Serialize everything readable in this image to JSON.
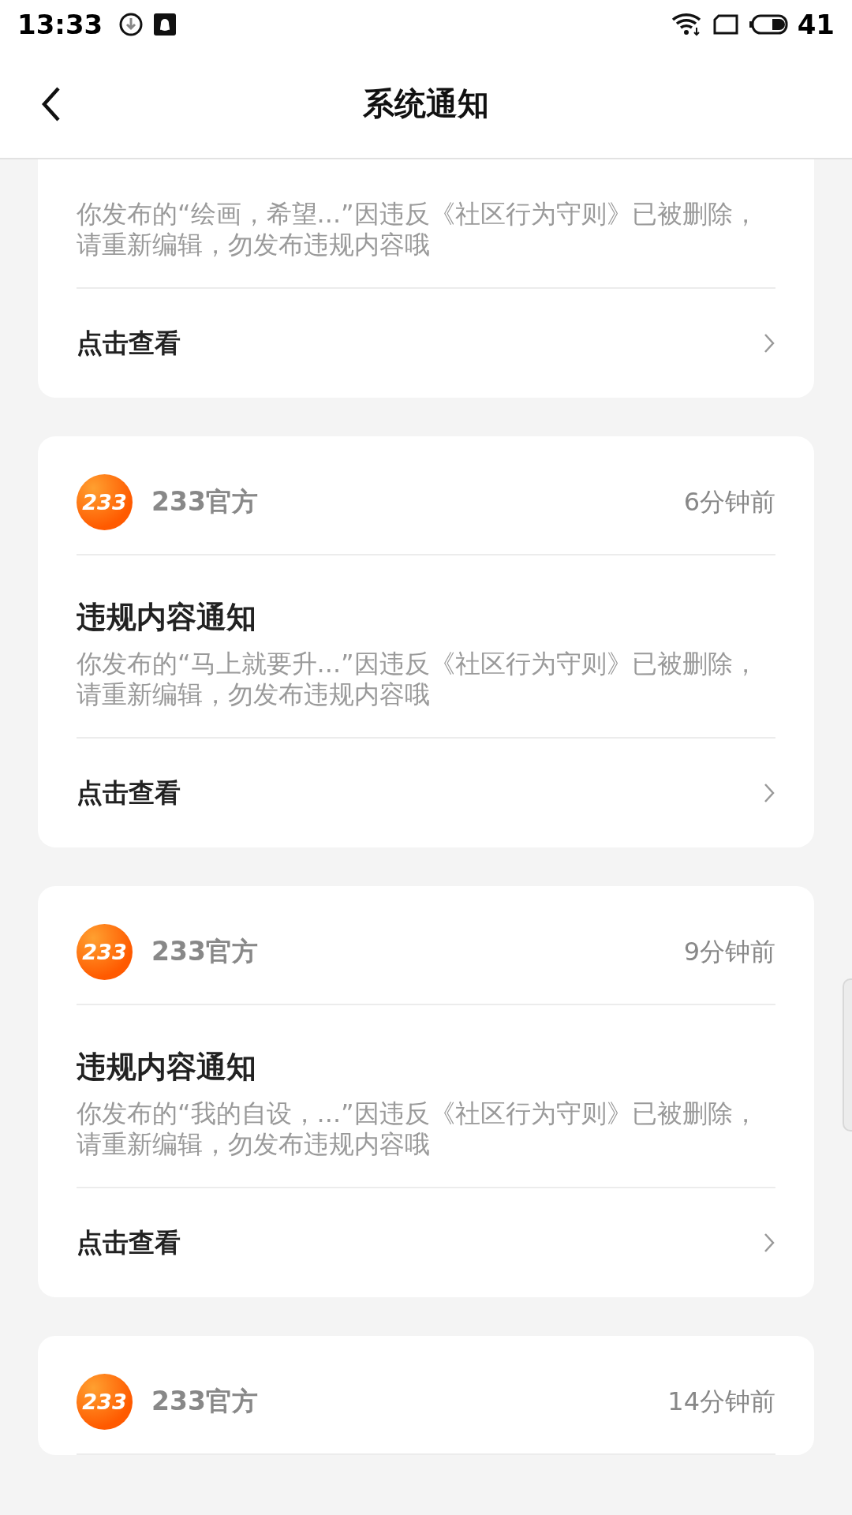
{
  "status_bar": {
    "time": "13:33",
    "battery": "41"
  },
  "header": {
    "title": "系统通知"
  },
  "notifications": [
    {
      "body": "你发布的“绘画，希望...”因违反《社区行为守则》已被删除，请重新编辑，勿发布违规内容哦",
      "action": "点击查看"
    },
    {
      "logo": "233",
      "source": "233官方",
      "time": "6分钟前",
      "title": "违规内容通知",
      "body": "你发布的“马上就要升...”因违反《社区行为守则》已被删除，请重新编辑，勿发布违规内容哦",
      "action": "点击查看"
    },
    {
      "logo": "233",
      "source": "233官方",
      "time": "9分钟前",
      "title": "违规内容通知",
      "body": "你发布的“我的自设，...”因违反《社区行为守则》已被删除，请重新编辑，勿发布违规内容哦",
      "action": "点击查看"
    },
    {
      "logo": "233",
      "source": "233官方",
      "time": "14分钟前"
    }
  ]
}
